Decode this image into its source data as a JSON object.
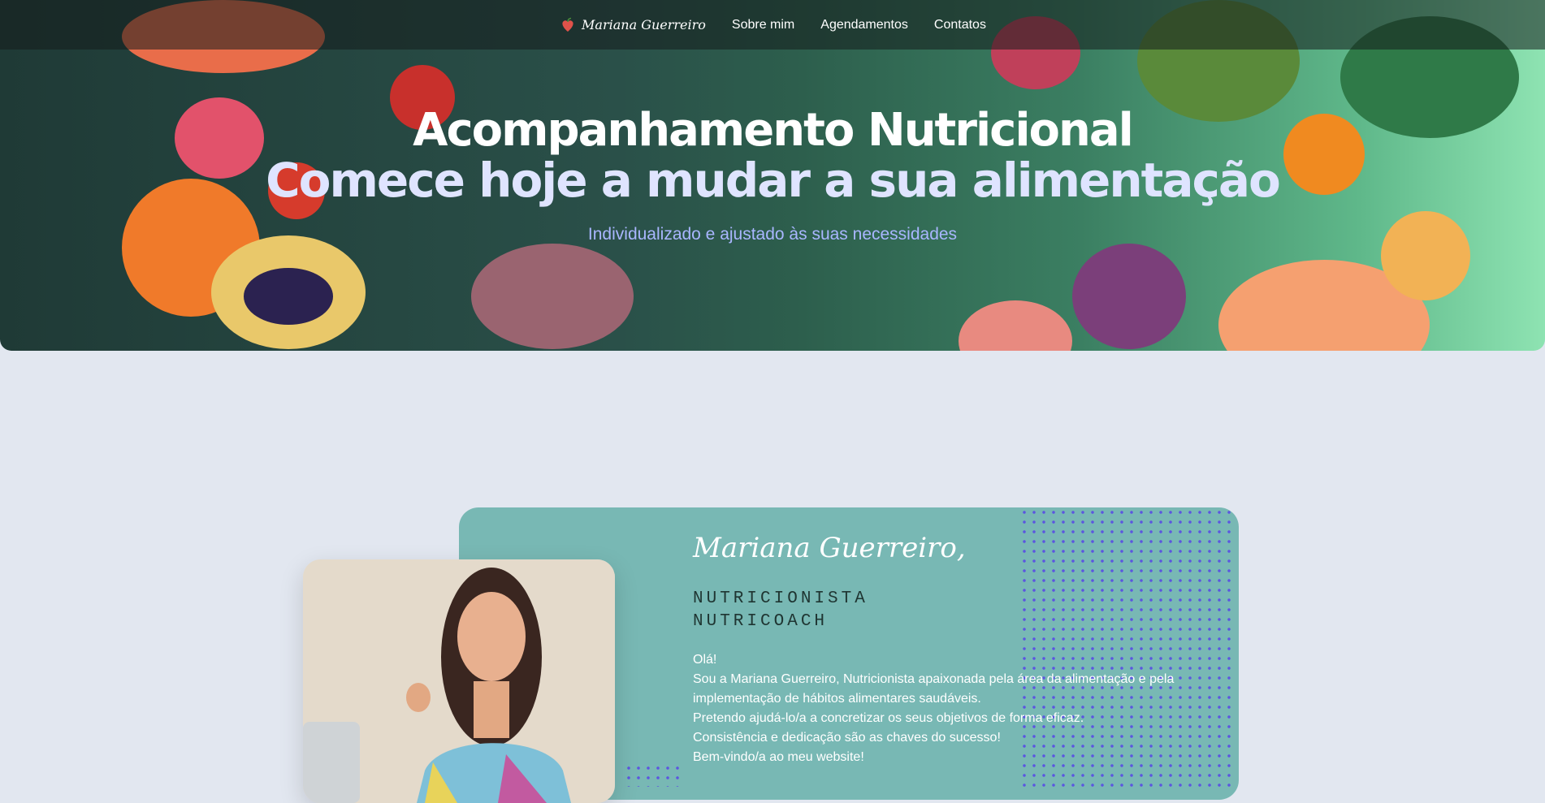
{
  "nav": {
    "brand": "Mariana Guerreiro",
    "links": [
      "Sobre mim",
      "Agendamentos",
      "Contatos"
    ]
  },
  "hero": {
    "title_line1": "Acompanhamento Nutricional",
    "title_line2": "Comece hoje a mudar a sua alimentação",
    "subtitle": "Individualizado e ajustado às suas necessidades"
  },
  "about": {
    "name": "Mariana Guerreiro,",
    "roles": [
      "NUTRICIONISTA",
      "NUTRICOACH"
    ],
    "paragraphs": [
      "Olá!",
      "Sou a Mariana Guerreiro, Nutricionista apaixonada pela área da alimentação e pela implementação de hábitos alimentares saudáveis.",
      "Pretendo ajudá-lo/a a concretizar os seus objetivos de forma eficaz.",
      "Consistência e dedicação são as chaves do sucesso!",
      "Bem-vindo/a ao meu website!"
    ]
  },
  "colors": {
    "card": "#78b8b4",
    "page_bg": "#e2e7f0",
    "dots": "#5b56e0",
    "subtitle": "#a9b6ff"
  }
}
